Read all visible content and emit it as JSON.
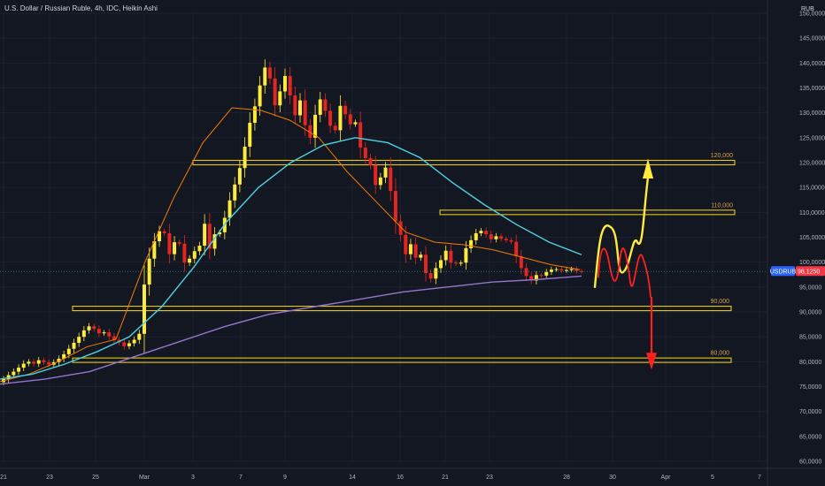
{
  "header": {
    "title": "U.S. Dollar / Russian Ruble, 4h, IDC, Heikin Ashi",
    "currency": "RUB"
  },
  "price_axis": {
    "ticks": [
      "150,0000",
      "145,0000",
      "140,0000",
      "135,0000",
      "130,0000",
      "125,0000",
      "120,0000",
      "115,0000",
      "110,0000",
      "105,0000",
      "100,0000",
      "95,0000",
      "90,0000",
      "85,0000",
      "80,0000",
      "75,0000",
      "70,0000",
      "65,0000",
      "60,0000"
    ]
  },
  "time_axis": {
    "ticks": [
      "21",
      "23",
      "25",
      "Mar",
      "3",
      "7",
      "9",
      "14",
      "16",
      "21",
      "23",
      "28",
      "30",
      "Apr",
      "5",
      "7"
    ]
  },
  "last_price": {
    "symbol": "USDRUB",
    "value": "98,1250",
    "symbol_color": "#2962ff",
    "value_color": "#f23645"
  },
  "colors": {
    "background": "#131722",
    "bull_candle": "#ffeb3b",
    "bear_candle": "#e52521",
    "zone_line": "#e6c619",
    "zone_label": "#d6a14a",
    "ma_fast": "#f57c00",
    "ma_mid": "#4dd0e1",
    "ma_slow": "#9575cd",
    "arrow_up": "#ffeb3b",
    "arrow_down": "#ff1f1f"
  },
  "chart_data": {
    "type": "candlestick",
    "title": "U.S. Dollar / Russian Ruble, 4h, IDC, Heikin Ashi",
    "ylim": [
      60,
      150
    ],
    "y_ticks": [
      150,
      145,
      140,
      135,
      130,
      125,
      120,
      115,
      110,
      105,
      100,
      95,
      90,
      85,
      80,
      75,
      70,
      65,
      60
    ],
    "x_ticks": [
      "21",
      "23",
      "25",
      "Mar",
      "3",
      "7",
      "9",
      "14",
      "16",
      "21",
      "23",
      "28",
      "30",
      "Apr",
      "5",
      "7"
    ],
    "last_price": 98.125,
    "price_line": 98.125,
    "zones": [
      {
        "label": "120,000",
        "value": 120.0
      },
      {
        "label": "110,000",
        "value": 110.0
      },
      {
        "label": "90,000",
        "value": 90.7
      },
      {
        "label": "80,000",
        "value": 80.3
      }
    ],
    "closes": [
      76.5,
      77.3,
      78.0,
      78.8,
      79.6,
      80.0,
      79.6,
      80.3,
      79.9,
      79.4,
      79.9,
      80.6,
      81.5,
      82.6,
      83.8,
      85.0,
      86.3,
      87.1,
      86.6,
      85.7,
      85.9,
      85.1,
      84.4,
      83.9,
      83.1,
      83.7,
      84.4,
      85.6,
      95.5,
      100.7,
      104.2,
      106.2,
      105.8,
      101.6,
      104.0,
      103.7,
      99.9,
      100.7,
      102.2,
      103.3,
      107.7,
      102.7,
      105.6,
      106.0,
      108.9,
      112.4,
      115.6,
      118.9,
      123.2,
      128.0,
      131.3,
      135.5,
      139.1,
      136.9,
      131.5,
      134.3,
      137.4,
      133.5,
      129.5,
      132.5,
      127.5,
      125.0,
      129.6,
      132.7,
      130.4,
      127.4,
      126.5,
      131.4,
      129.7,
      127.7,
      128.1,
      123.0,
      120.9,
      119.5,
      115.5,
      117.0,
      119.0,
      114.3,
      108.2,
      105.5,
      101.6,
      103.6,
      100.9,
      101.5,
      97.8,
      96.7,
      98.8,
      100.4,
      102.3,
      99.9,
      99.7,
      99.9,
      102.8,
      104.4,
      105.8,
      106.3,
      105.6,
      104.6,
      105.2,
      104.7,
      104.4,
      104.1,
      101.2,
      98.8,
      97.2,
      96.3,
      97.4,
      97.3,
      98.0,
      98.5,
      98.6,
      98.3,
      98.4,
      98.6,
      98.2,
      98.1
    ],
    "overlays": [
      {
        "name": "MA fast",
        "values": [
          76.0,
          77.5,
          80.0,
          83.0,
          84.5,
          100.0,
          113.0,
          124.0,
          131.0,
          130.5,
          128.5,
          125.0,
          118.0,
          112.0,
          106.0,
          104.0,
          103.5,
          102.5,
          101.0,
          99.5,
          98.5
        ]
      },
      {
        "name": "MA mid",
        "values": [
          76.5,
          77.5,
          79.5,
          82.0,
          85.0,
          91.0,
          99.0,
          108.0,
          115.0,
          120.0,
          123.5,
          125.0,
          124.0,
          121.0,
          116.0,
          111.5,
          107.5,
          104.0,
          101.5
        ]
      },
      {
        "name": "MA slow",
        "values": [
          75.5,
          76.5,
          78.0,
          81.0,
          84.0,
          87.0,
          89.5,
          91.0,
          92.5,
          94.0,
          95.0,
          96.0,
          96.5,
          97.2
        ]
      }
    ],
    "scenario": {
      "up_target": 120.0,
      "down_target": 80.0
    }
  }
}
